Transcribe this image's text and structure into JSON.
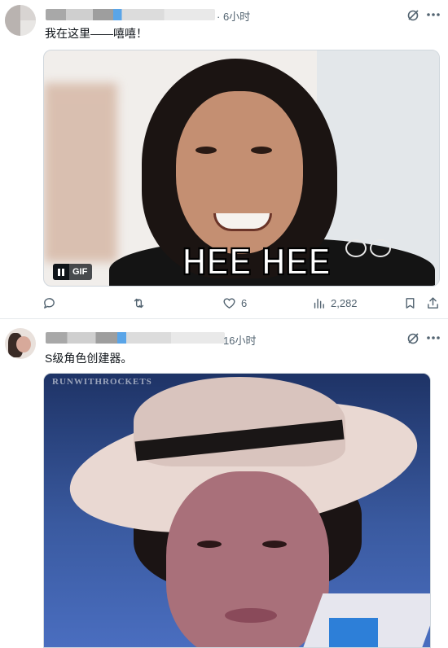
{
  "posts": [
    {
      "time": "· 6小时",
      "text": "我在这里——嘻嘻！",
      "media": {
        "caption": "HEE HEE",
        "gif_label": "GIF"
      },
      "actions": {
        "reply_count": "",
        "repost_count": "",
        "like_count": "6",
        "views_count": "2,282"
      }
    },
    {
      "time": "16小时",
      "text": "S级角色创建器。",
      "media": {
        "watermark": "RUNWITHROCKETS"
      }
    }
  ],
  "icons": {
    "grok": "grok-icon",
    "more": "more-icon",
    "reply": "reply-icon",
    "repost": "repost-icon",
    "like": "heart-icon",
    "views": "views-icon",
    "bookmark": "bookmark-icon",
    "share": "share-icon"
  },
  "colors": {
    "text": "#0f1419",
    "secondary": "#536471",
    "divider": "#e6e9ec"
  }
}
